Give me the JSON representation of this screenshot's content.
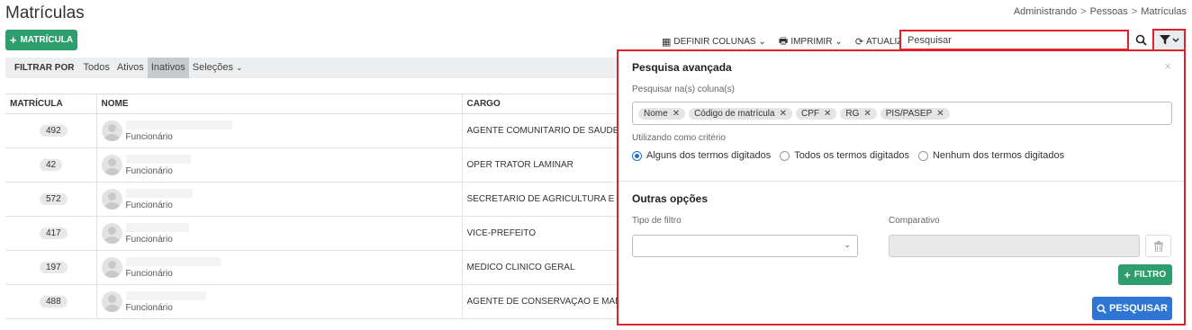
{
  "page": {
    "title": "Matrículas",
    "breadcrumb": [
      "Administrando",
      "Pessoas",
      "Matrículas"
    ],
    "breadcrumb_sep": ">"
  },
  "actions": {
    "new_label": "MATRÍCULA",
    "define_columns": "DEFINIR COLUNAS",
    "print": "IMPRIMIR",
    "refresh": "ATUALIZAR",
    "search_placeholder": "Pesquisar"
  },
  "filterbar": {
    "label": "FILTRAR POR",
    "options": [
      "Todos",
      "Ativos",
      "Inativos"
    ],
    "active": "Inativos",
    "selections": "Seleções"
  },
  "table": {
    "headers": [
      "MATRÍCULA",
      "NOME",
      "CARGO"
    ],
    "rows": [
      {
        "matricula": "492",
        "role": "Funcionário",
        "cargo": "AGENTE COMUNITÁRIO DE SAÚDE"
      },
      {
        "matricula": "42",
        "role": "Funcionário",
        "cargo": "OPER TRATOR LAMINAR"
      },
      {
        "matricula": "572",
        "role": "Funcionário",
        "cargo": "SECRETÁRIO DE AGRICULTURA E MEI"
      },
      {
        "matricula": "417",
        "role": "Funcionário",
        "cargo": "VICE-PREFEITO"
      },
      {
        "matricula": "197",
        "role": "Funcionário",
        "cargo": "MEDICO CLINICO GERAL"
      },
      {
        "matricula": "488",
        "role": "Funcionário",
        "cargo": "AGENTE DE CONSERVAÇÃO E MANUT"
      }
    ]
  },
  "advanced": {
    "title": "Pesquisa avançada",
    "close": "×",
    "columns_label": "Pesquisar na(s) coluna(s)",
    "tags": [
      "Nome",
      "Código de matrícula",
      "CPF",
      "RG",
      "PIS/PASEP"
    ],
    "criteria_label": "Utilizando como critério",
    "criteria": [
      "Alguns dos termos digitados",
      "Todos os termos digitados",
      "Nenhum dos termos digitados"
    ],
    "criteria_selected": 0,
    "other_title": "Outras opções",
    "filter_type_label": "Tipo de filtro",
    "comparative_label": "Comparativo",
    "add_filter": "FILTRO",
    "search_button": "PESQUISAR"
  },
  "colors": {
    "green": "#2e9e6e",
    "blue": "#2f76d4",
    "highlight_red": "#e0212b"
  }
}
